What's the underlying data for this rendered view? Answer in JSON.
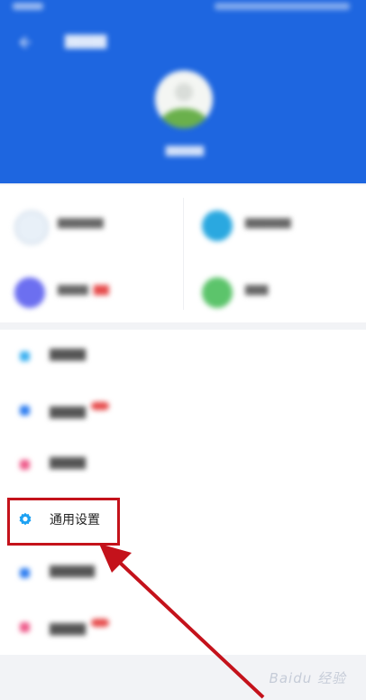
{
  "menu": {
    "general_settings_label": "通用设置"
  },
  "watermark": "Baidu 经验",
  "icons": {
    "general_settings": "gear-icon",
    "back": "back-arrow-icon"
  },
  "colors": {
    "header_bg": "#1e66e0",
    "highlight_border": "#c4121b",
    "gear_icon": "#1da1f2"
  }
}
